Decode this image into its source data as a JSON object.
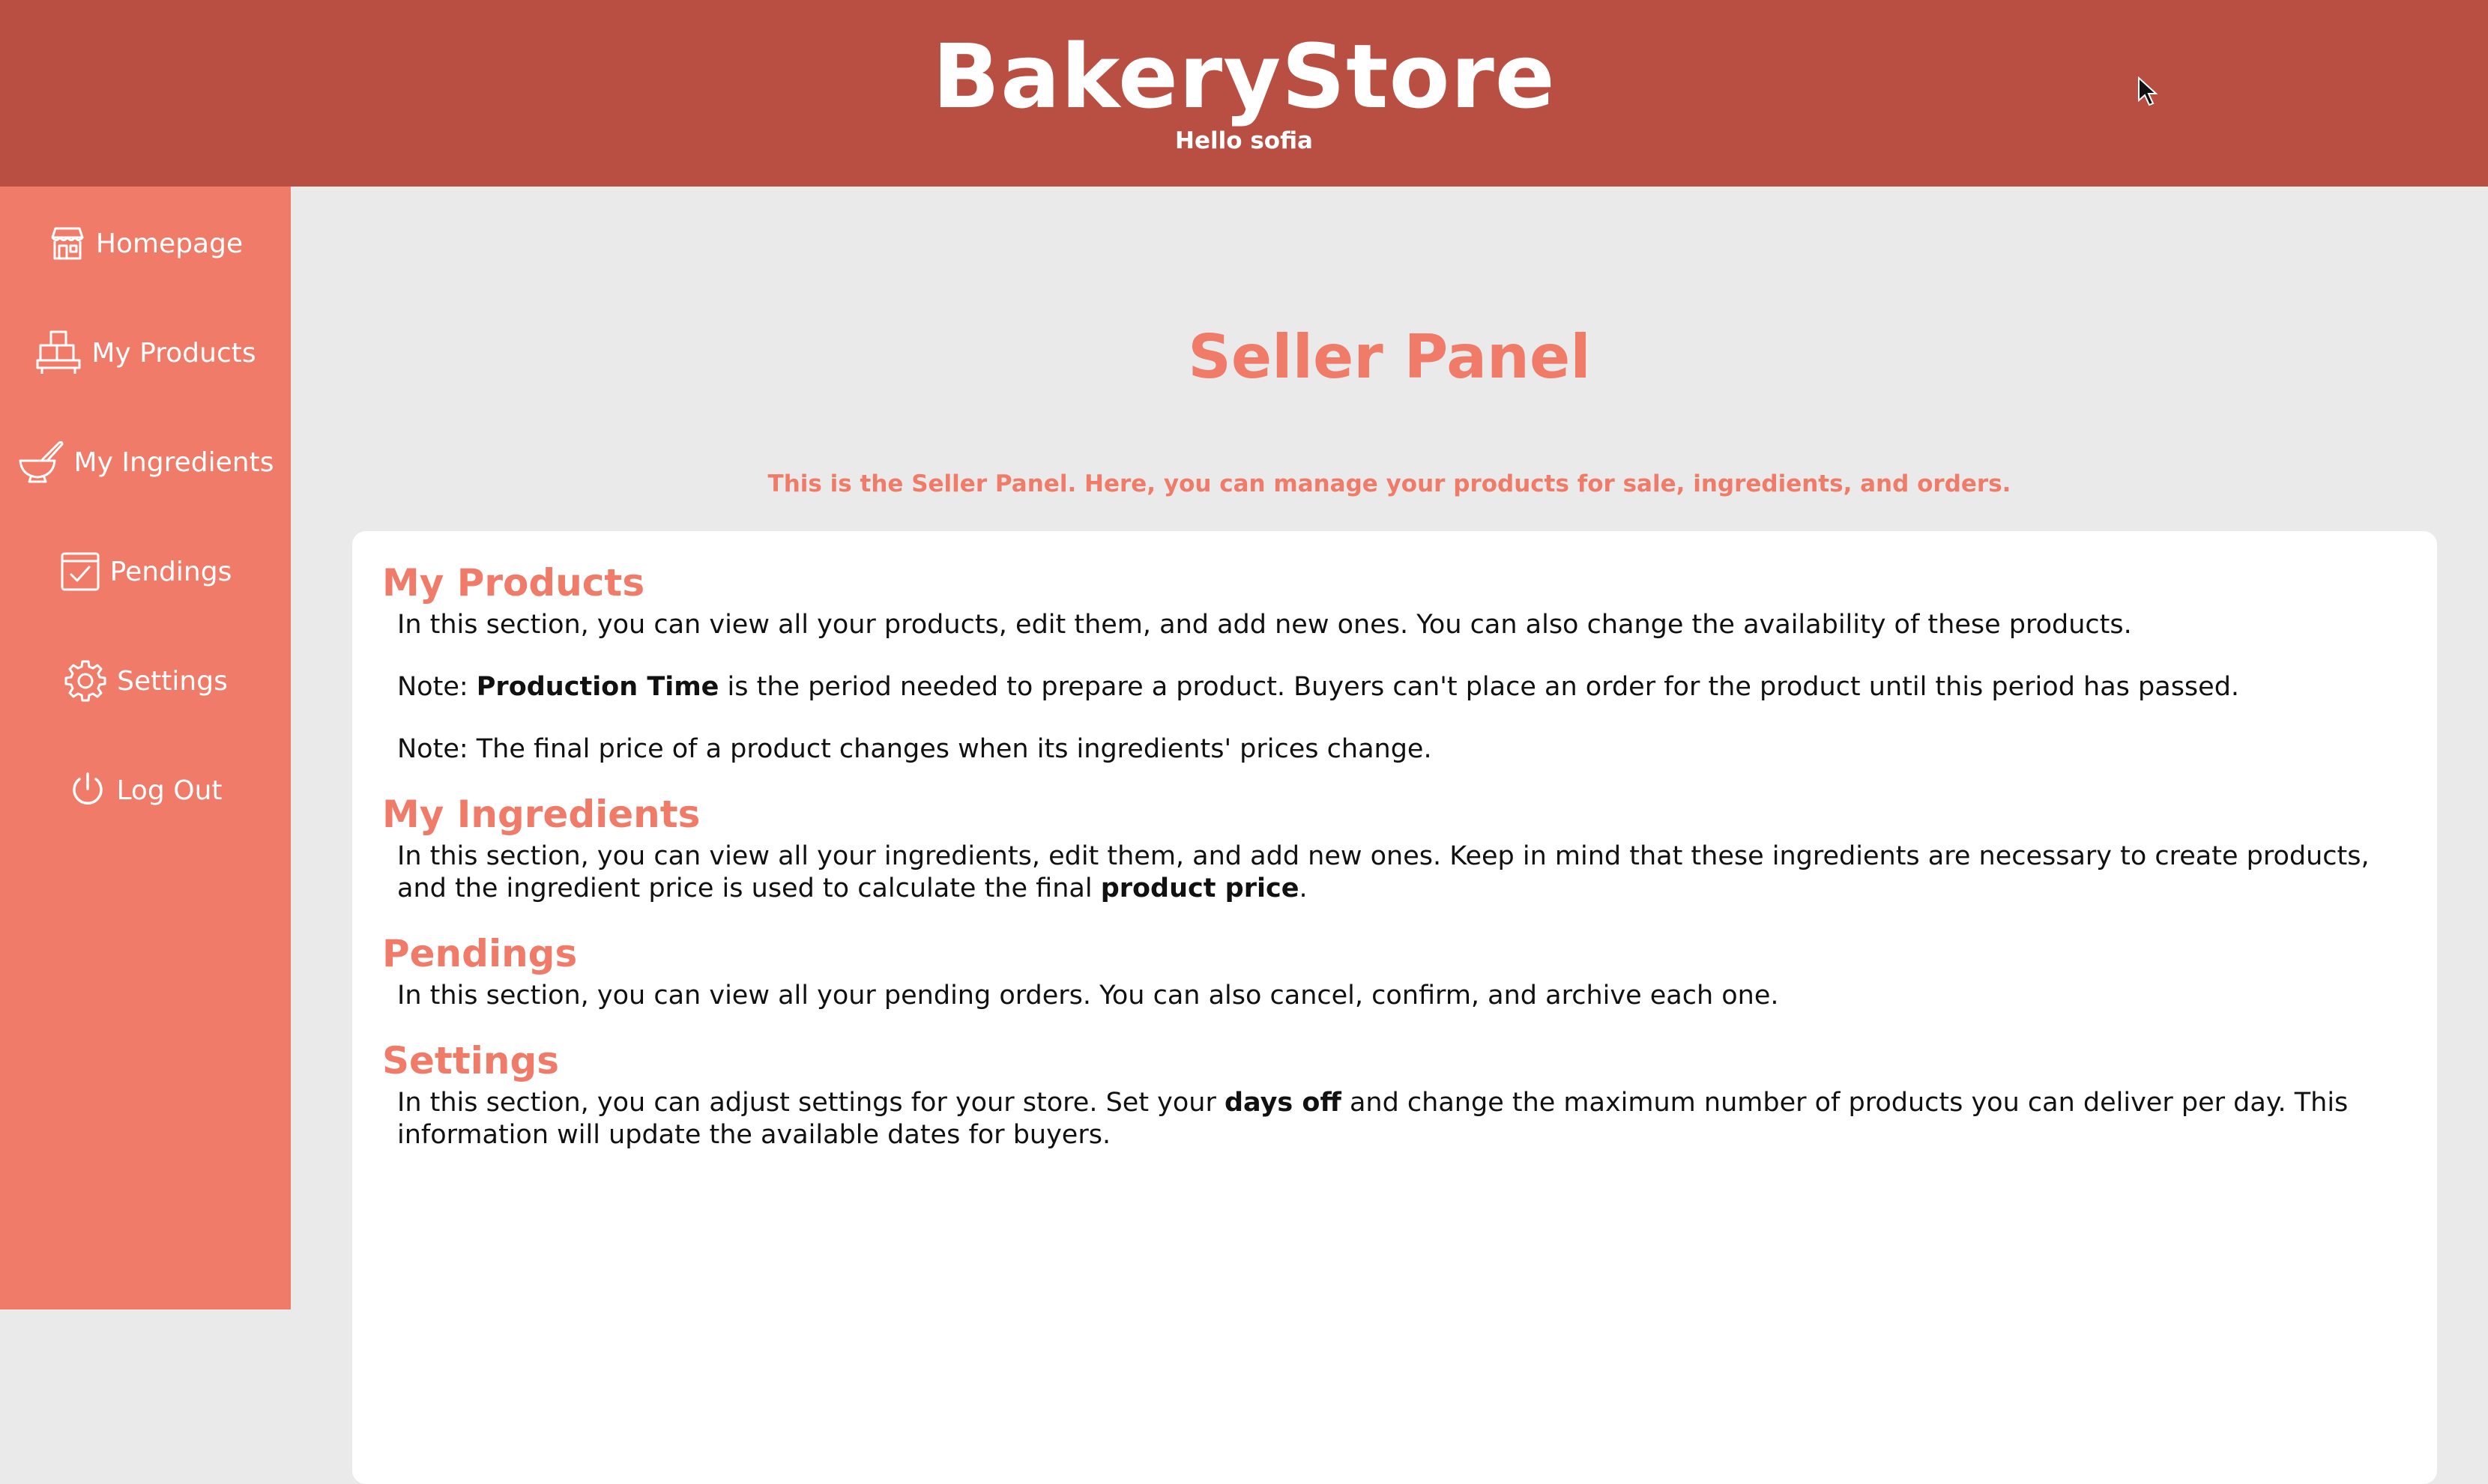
{
  "header": {
    "brand": "BakeryStore",
    "greeting": "Hello sofia",
    "background": "#b94f42"
  },
  "sidebar": {
    "background": "#ef7b68",
    "items": [
      {
        "label": "Homepage",
        "icon": "store-icon"
      },
      {
        "label": "My Products",
        "icon": "stacked-boxes-icon"
      },
      {
        "label": "My Ingredients",
        "icon": "mortar-bowl-icon"
      },
      {
        "label": "Pendings",
        "icon": "checklist-icon"
      },
      {
        "label": "Settings",
        "icon": "gear-icon"
      },
      {
        "label": "Log Out",
        "icon": "power-icon"
      }
    ]
  },
  "main": {
    "title": "Seller Panel",
    "intro": "This is the Seller Panel. Here, you can manage your products for sale, ingredients, and orders.",
    "accent": "#ef7b68",
    "sections": {
      "products": {
        "title": "My Products",
        "p1": "In this section, you can view all your products, edit them, and add new ones. You can also change the availability of these products.",
        "p2_prefix": "Note: ",
        "p2_bold": "Production Time",
        "p2_suffix": " is the period needed to prepare a product. Buyers can't place an order for the product until this period has passed.",
        "p3": "Note: The final price of a product changes when its ingredients' prices change."
      },
      "ingredients": {
        "title": "My Ingredients",
        "p1_prefix": "In this section, you can view all your ingredients, edit them, and add new ones. Keep in mind that these ingredients are necessary to create products, and the ingredient price is used to calculate the final ",
        "p1_bold": "product price",
        "p1_suffix": "."
      },
      "pendings": {
        "title": "Pendings",
        "p1": "In this section, you can view all your pending orders. You can also cancel, confirm, and archive each one."
      },
      "settings": {
        "title": "Settings",
        "p1_prefix": "In this section, you can adjust settings for your store. Set your ",
        "p1_bold": "days off",
        "p1_suffix": " and change the maximum number of products you can deliver per day. This information will update the available dates for buyers."
      }
    }
  }
}
